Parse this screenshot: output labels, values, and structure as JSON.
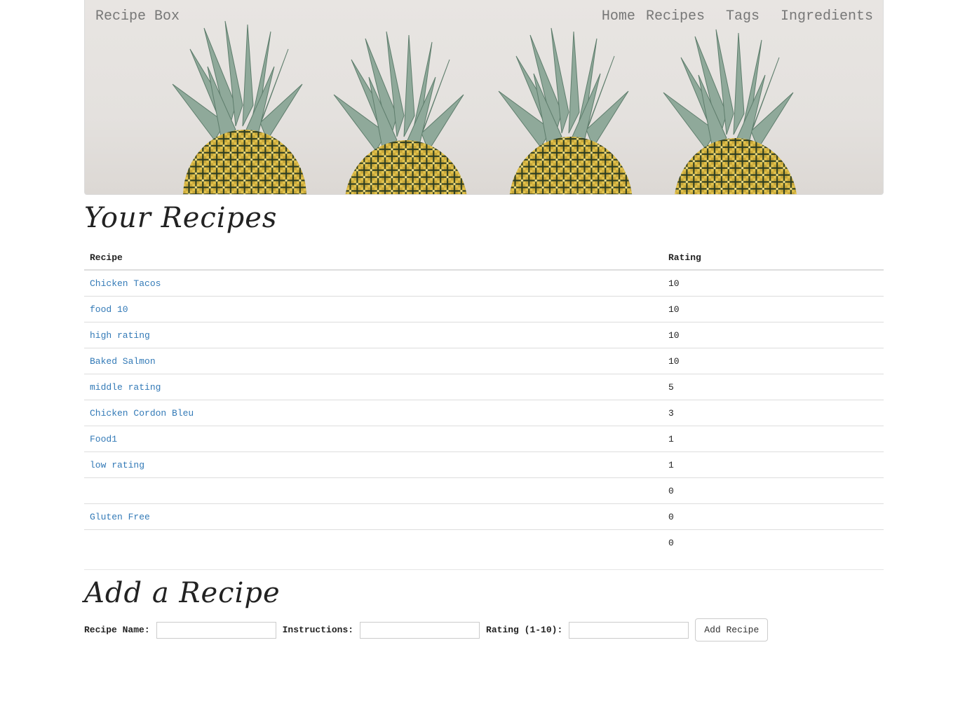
{
  "navbar": {
    "brand": "Recipe Box",
    "links": [
      "Home",
      "Recipes",
      "Tags",
      "Ingredients"
    ]
  },
  "recipes_section": {
    "title": "Your Recipes",
    "columns": [
      "Recipe",
      "Rating"
    ],
    "rows": [
      {
        "name": "Chicken Tacos",
        "rating": "10"
      },
      {
        "name": "food 10",
        "rating": "10"
      },
      {
        "name": "high rating",
        "rating": "10"
      },
      {
        "name": "Baked Salmon",
        "rating": "10"
      },
      {
        "name": "middle rating",
        "rating": "5"
      },
      {
        "name": "Chicken Cordon Bleu",
        "rating": "3"
      },
      {
        "name": "Food1",
        "rating": "1"
      },
      {
        "name": "low rating",
        "rating": "1"
      },
      {
        "name": "",
        "rating": "0"
      },
      {
        "name": "Gluten Free",
        "rating": "0"
      },
      {
        "name": "",
        "rating": "0"
      }
    ]
  },
  "add_section": {
    "title": "Add a Recipe",
    "name_label": "Recipe Name:",
    "name_value": "",
    "instructions_label": "Instructions:",
    "instructions_value": "",
    "rating_label": "Rating (1-10):",
    "rating_value": "",
    "submit_label": "Add Recipe"
  },
  "colors": {
    "link": "#337ab7",
    "nav_text": "#777777",
    "hero_background": "#e6e3e0"
  },
  "hero_image": "pineapples-banner"
}
